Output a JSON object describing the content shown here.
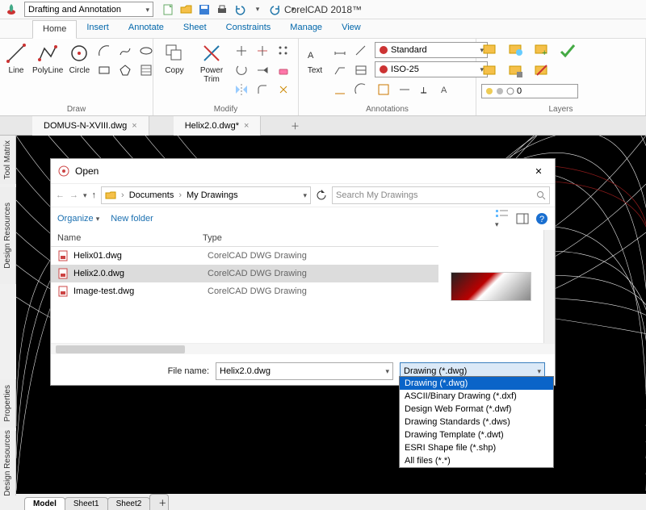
{
  "app_title": "CorelCAD 2018™",
  "workspace": "Drafting and Annotation",
  "ribbon_tabs": [
    "Home",
    "Insert",
    "Annotate",
    "Sheet",
    "Constraints",
    "Manage",
    "View"
  ],
  "active_ribbon_tab": "Home",
  "groups": {
    "draw": {
      "label": "Draw",
      "line": "Line",
      "polyline": "PolyLine",
      "circle": "Circle"
    },
    "modify": {
      "label": "Modify",
      "copy": "Copy",
      "powertrim": "Power Trim"
    },
    "annotations": {
      "label": "Annotations",
      "text": "Text",
      "dimstyle": "Standard",
      "dimset": "ISO-25"
    },
    "layers": {
      "label": "Layers",
      "current": "0"
    }
  },
  "doc_tabs": [
    {
      "name": "DOMUS-N-XVIII.dwg",
      "dirty": false
    },
    {
      "name": "Helix2.0.dwg*",
      "dirty": true
    }
  ],
  "side_tabs": [
    "Tool Matrix",
    "Design Resources",
    "Properties",
    "Design Resources"
  ],
  "sheet_tabs": [
    "Model",
    "Sheet1",
    "Sheet2"
  ],
  "active_sheet": "Model",
  "dialog": {
    "title": "Open",
    "breadcrumb": [
      "Documents",
      "My Drawings"
    ],
    "search_placeholder": "Search My Drawings",
    "organize": "Organize",
    "newfolder": "New folder",
    "columns": {
      "name": "Name",
      "type": "Type"
    },
    "files": [
      {
        "name": "Helix01.dwg",
        "type": "CorelCAD DWG Drawing"
      },
      {
        "name": "Helix2.0.dwg",
        "type": "CorelCAD DWG Drawing"
      },
      {
        "name": "Image-test.dwg",
        "type": "CorelCAD DWG Drawing"
      }
    ],
    "selected_file_index": 1,
    "filename_label": "File name:",
    "filename_value": "Helix2.0.dwg",
    "filter_value": "Drawing (*.dwg)",
    "filter_options": [
      "Drawing (*.dwg)",
      "ASCII/Binary Drawing (*.dxf)",
      "Design Web Format (*.dwf)",
      "Drawing Standards (*.dws)",
      "Drawing Template (*.dwt)",
      "ESRI Shape file (*.shp)",
      "All files (*.*)"
    ],
    "filter_selected_index": 0
  }
}
